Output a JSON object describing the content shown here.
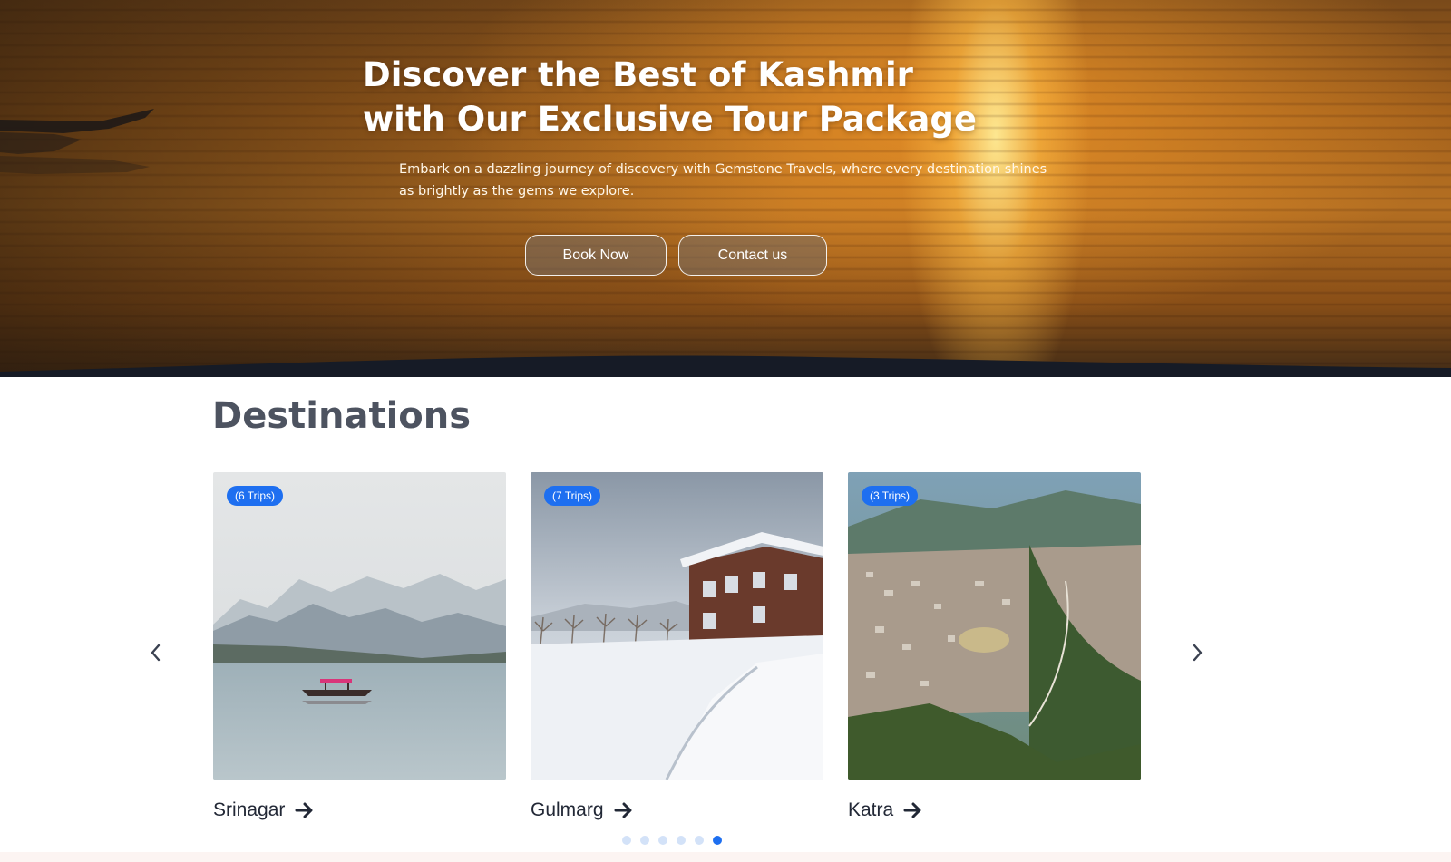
{
  "hero": {
    "title_line1": "Discover the Best of Kashmir",
    "title_line2": "with Our Exclusive Tour Package",
    "subtitle": "Embark on a dazzling journey of discovery with Gemstone Travels, where every destination shines as brightly as the gems we explore.",
    "book_label": "Book Now",
    "contact_label": "Contact us"
  },
  "destinations": {
    "heading": "Destinations",
    "cards": [
      {
        "name": "Srinagar",
        "trips": "(6 Trips)"
      },
      {
        "name": "Gulmarg",
        "trips": "(7 Trips)"
      },
      {
        "name": "Katra",
        "trips": "(3 Trips)"
      }
    ],
    "carousel": {
      "total_dots": 6,
      "active_dot": 6
    }
  },
  "colors": {
    "accent": "#1e6ff0",
    "heading": "#4d5360",
    "dark_band": "#161b26"
  },
  "icons": {
    "prev": "chevron-left-icon",
    "next": "chevron-right-icon",
    "card_link": "arrow-right-icon"
  }
}
